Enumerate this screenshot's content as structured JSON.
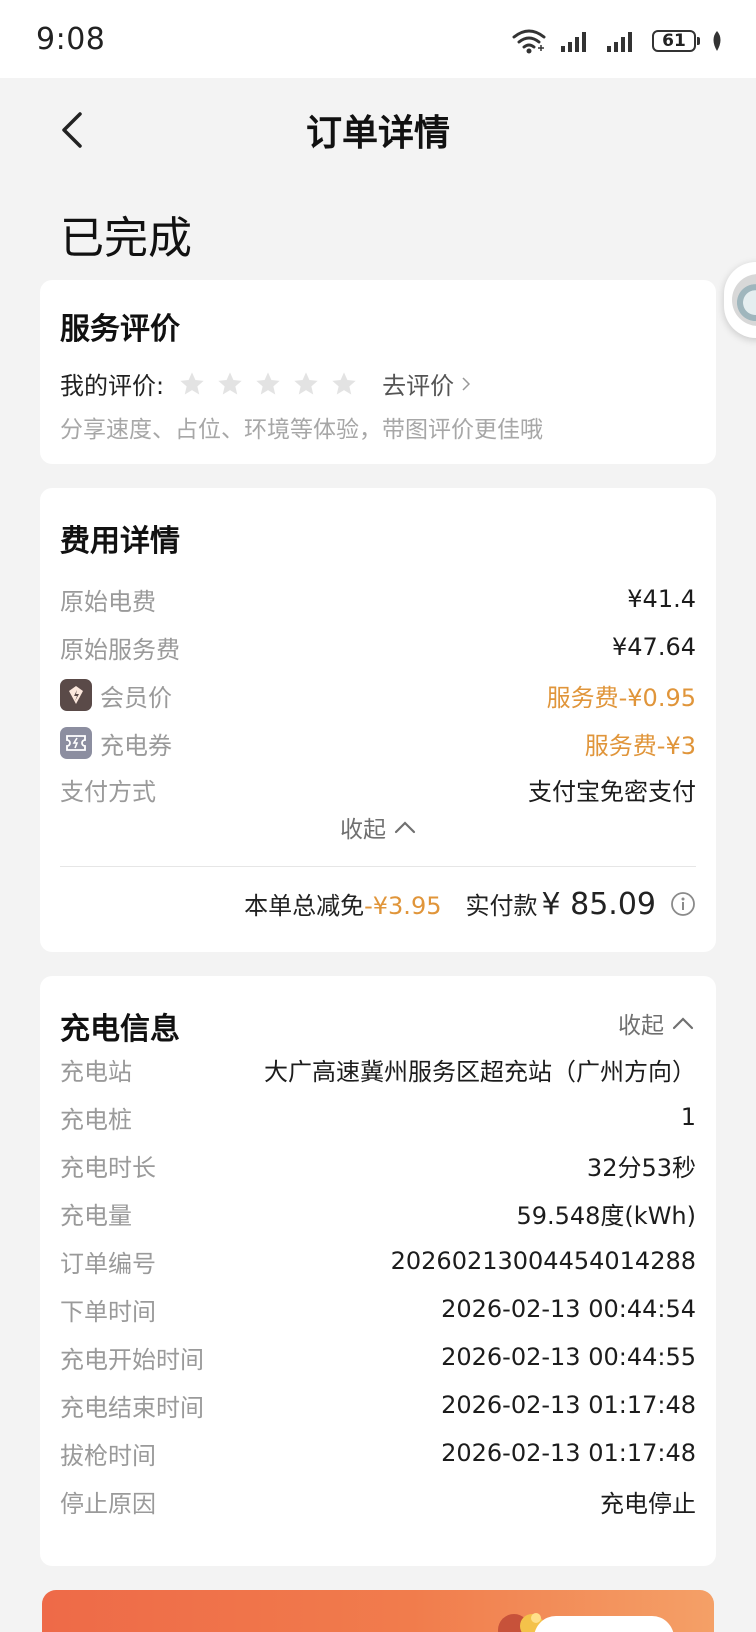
{
  "status_bar": {
    "time": "9:08",
    "battery": "61",
    "icons": [
      "wifi-icon",
      "signal-icon",
      "signal-icon",
      "battery-icon",
      "leaf-icon"
    ]
  },
  "header": {
    "title": "订单详情",
    "back_icon": "chevron-left-icon"
  },
  "order_status": "已完成",
  "review": {
    "title": "服务评价",
    "my_rating_label": "我的评价:",
    "star_count": 5,
    "rating": 0,
    "action_label": "去评价",
    "hint": "分享速度、占位、环境等体验，带图评价更佳哦"
  },
  "fee": {
    "title": "费用详情",
    "rows": [
      {
        "label": "原始电费",
        "value": "¥41.4"
      },
      {
        "label": "原始服务费",
        "value": "¥47.64"
      },
      {
        "label": "会员价",
        "value": "服务费-¥0.95"
      },
      {
        "label": "充电券",
        "value": "服务费-¥3"
      },
      {
        "label": "支付方式",
        "value": "支付宝免密支付"
      }
    ],
    "collapse_label": "收起",
    "discount_label": "本单总减免",
    "discount_value": "-¥3.95",
    "paid_label": "实付款",
    "paid_amount": "¥ 85.09"
  },
  "charging": {
    "title": "充电信息",
    "collapse_label": "收起",
    "rows": [
      {
        "label": "充电站",
        "value": "大广高速冀州服务区超充站（广州方向）"
      },
      {
        "label": "充电桩",
        "value": "1"
      },
      {
        "label": "充电时长",
        "value": "32分53秒"
      },
      {
        "label": "充电量",
        "value": "59.548度(kWh)"
      },
      {
        "label": "订单编号",
        "value": "20260213004454014288"
      },
      {
        "label": "下单时间",
        "value": "2026-02-13 00:44:54"
      },
      {
        "label": "充电开始时间",
        "value": "2026-02-13 00:44:55"
      },
      {
        "label": "充电结束时间",
        "value": "2026-02-13 01:17:48"
      },
      {
        "label": "拔枪时间",
        "value": "2026-02-13 01:17:48"
      },
      {
        "label": "停止原因",
        "value": "充电停止"
      }
    ]
  },
  "colors": {
    "accent_orange": "#e0953a",
    "banner_start": "#ee6a48",
    "banner_end": "#f4a067"
  }
}
